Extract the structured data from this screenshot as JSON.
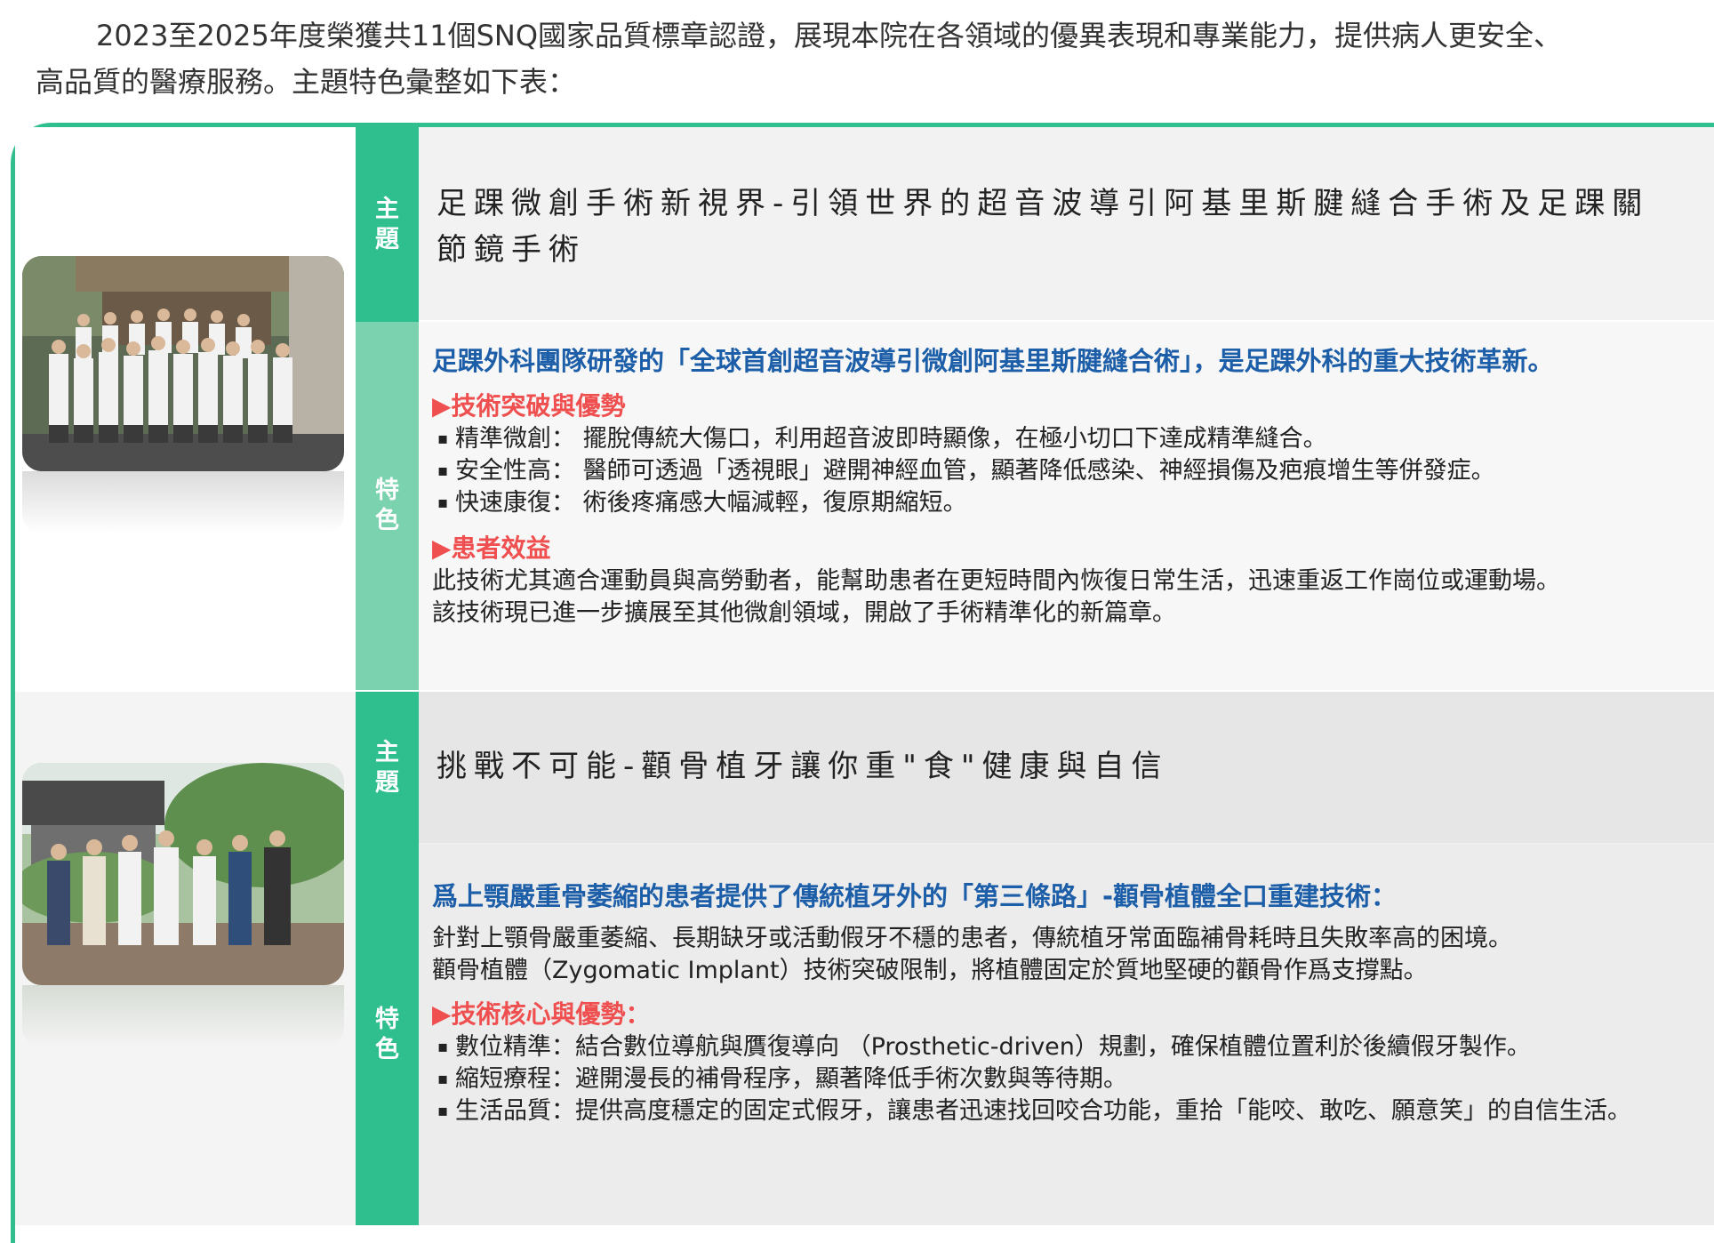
{
  "intro": {
    "line1": "2023至2025年度榮獲共11個SNQ國家品質標章認證，展現本院在各領域的優異表現和專業能力，提供病人更安全、",
    "line2": "高品質的醫療服務。主題特色彙整如下表："
  },
  "labels": {
    "theme": "主題",
    "feature": "特色"
  },
  "cards": [
    {
      "theme_title": "足踝微創手術新視界-引領世界的超音波導引阿基里斯腱縫合手術及足踝關節鏡手術",
      "headline": "足踝外科團隊研發的「全球首創超音波導引微創阿基里斯腱縫合術」，是足踝外科的重大技術革新。",
      "section1_title": "▶技術突破與優勢",
      "bullets": [
        "精準微創： 擺脫傳統大傷口，利用超音波即時顯像，在極小切口下達成精準縫合。",
        "安全性高： 醫師可透過「透視眼」避開神經血管，顯著降低感染、神經損傷及疤痕增生等併發症。",
        "快速康復： 術後疼痛感大幅減輕，復原期縮短。"
      ],
      "section2_title": "▶患者效益",
      "paragraph": [
        "此技術尤其適合運動員與高勞動者，能幫助患者在更短時間內恢復日常生活，迅速重返工作崗位或運動場。",
        "該技術現已進一步擴展至其他微創領域，開啟了手術精準化的新篇章。"
      ]
    },
    {
      "theme_title": "挑戰不可能-顴骨植牙讓你重\"食\"健康與自信",
      "headline": "爲上顎嚴重骨萎縮的患者提供了傳統植牙外的「第三條路」-顴骨植體全口重建技術：",
      "paragraph": [
        "針對上顎骨嚴重萎縮、長期缺牙或活動假牙不穩的患者，傳統植牙常面臨補骨耗時且失敗率高的困境。",
        "顴骨植體（Zygomatic Implant）技術突破限制，將植體固定於質地堅硬的顴骨作爲支撐點。"
      ],
      "section1_title": "▶技術核心與優勢：",
      "bullets": [
        "數位精準：結合數位導航與贋復導向 （Prosthetic-driven）規劃，確保植體位置利於後續假牙製作。",
        "縮短療程：避開漫長的補骨程序，顯著降低手術次數與等待期。",
        "生活品質：提供高度穩定的固定式假牙，讓患者迅速找回咬合功能，重拾「能咬、敢吃、願意笑」的自信生活。"
      ]
    }
  ],
  "colors": {
    "accent": "#2fbf8f",
    "accent_light": "#7bd2ae",
    "headline_blue": "#1d5ea8",
    "subhead_red": "#ef4f4f"
  }
}
